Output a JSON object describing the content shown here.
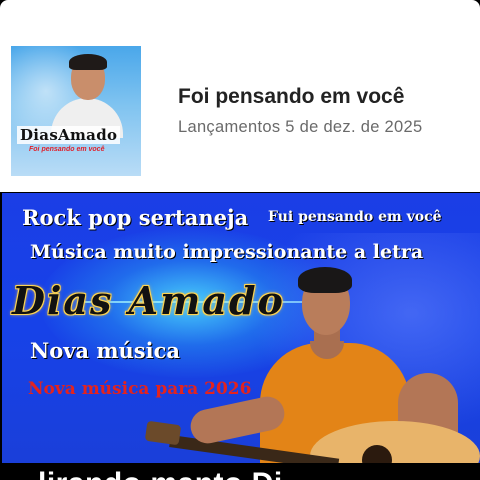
{
  "release": {
    "artist_cover_name": "DiasAmado",
    "cover_song_text": "Foi pensando em você",
    "title": "Foi pensando em você",
    "meta": "Lançamentos 5 de dez. de 2025"
  },
  "video": {
    "genre": "Rock pop sertaneja",
    "song_tag": "Fui pensando em você",
    "description": "Música muito impressionante a letra",
    "artist_logo": "Dias Amado",
    "new_song": "Nova música",
    "new_song_year": "Nova música para 2026"
  },
  "bottom": {
    "partial_text": "lirando manto Di"
  },
  "colors": {
    "video_background": "#1b3ee6",
    "logo_gold": "#ffd54a",
    "red_text": "#e3231f",
    "shirt_orange": "#e38417"
  }
}
